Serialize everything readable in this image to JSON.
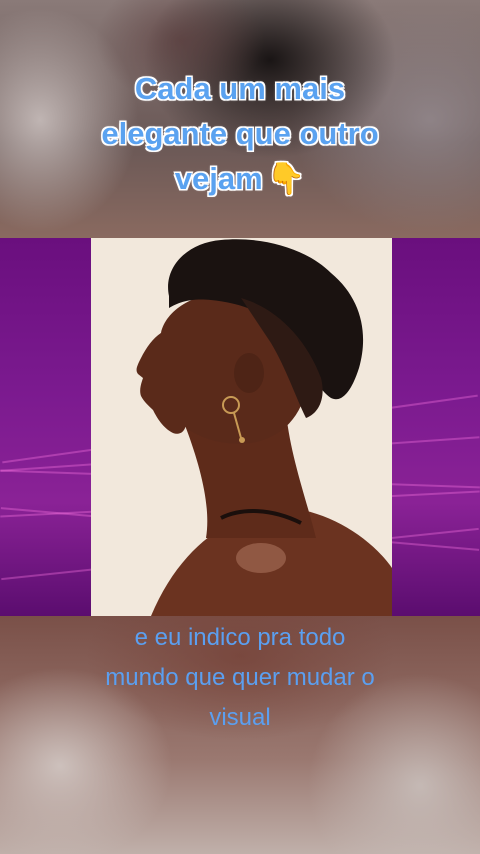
{
  "caption_top": {
    "line1": "Cada um mais",
    "line2": "elegante que outro",
    "line3": "vejam",
    "emoji": "👇"
  },
  "caption_bottom": {
    "line1": "e eu indico pra todo",
    "line2": "mundo que quer mudar o",
    "line3": "visual"
  },
  "colors": {
    "caption_text": "#5aa2f0",
    "band_purple": "#7b1a8f",
    "photo_background": "#f2e8dc",
    "skin": "#5a2c1c"
  }
}
